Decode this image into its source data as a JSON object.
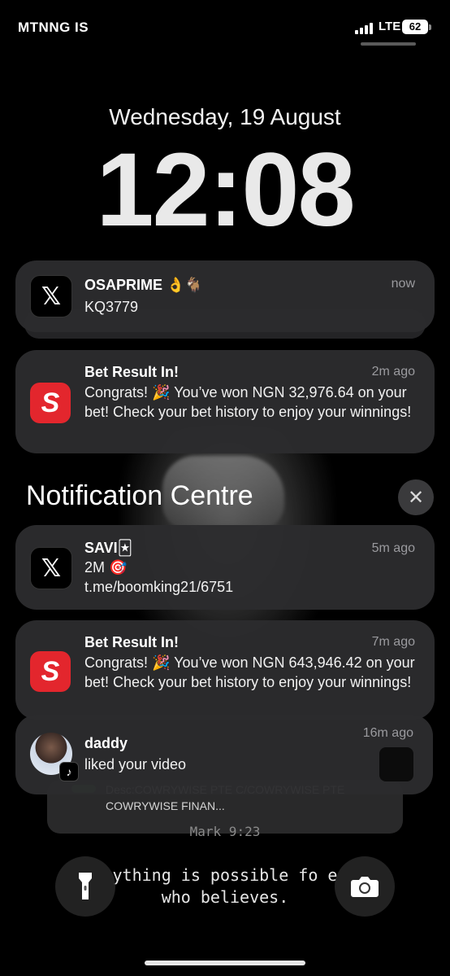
{
  "status_bar": {
    "carrier": "MTNNG IS",
    "network": "LTE",
    "battery": "62"
  },
  "lock_screen": {
    "date": "Wednesday, 19 August",
    "time": "12:08"
  },
  "notifications_top": [
    {
      "app": "X",
      "title": "OSAPRIME 👌🐐",
      "body": "KQ3779",
      "time": "now"
    },
    {
      "app": "Sportybet",
      "title": "Bet Result In!",
      "body": "Congrats! 🎉 You’ve won NGN 32,976.64 on your bet! Check your bet history to enjoy your winnings!",
      "time": "2m ago"
    }
  ],
  "notification_centre": {
    "header": "Notification Centre",
    "close_icon": "close-icon",
    "items": [
      {
        "app": "X",
        "title": "SAVI🃏",
        "body_line1": "2M 🎯",
        "body_line2": "t.me/boomking21/6751",
        "time": "5m ago"
      },
      {
        "app": "Sportybet",
        "title": "Bet Result In!",
        "body": "Congrats! 🎉 You’ve won NGN 643,946.42 on your bet! Check your bet history to enjoy your winnings!",
        "time": "7m ago"
      },
      {
        "app": "TikTok",
        "title": "daddy",
        "body": "liked your video",
        "time": "16m ago"
      }
    ],
    "stacked_preview": "Desc:COWRYWISE PTE C/COWRYWISE PTE COWRYWISE FINAN..."
  },
  "wallpaper": {
    "verse_ref": "Mark 9:23",
    "verse_line1": "ything is possible fo   e",
    "verse_line2": "who believes."
  },
  "bottom_controls": {
    "left": "flashlight-icon",
    "right": "camera-icon"
  }
}
